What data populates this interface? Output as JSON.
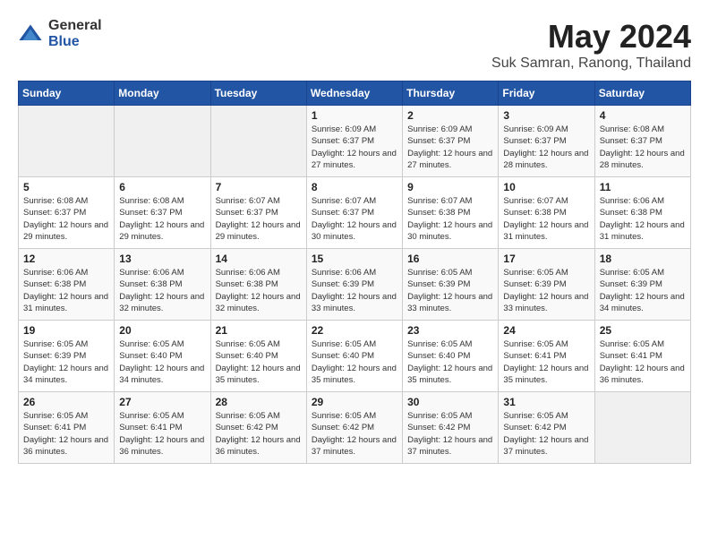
{
  "header": {
    "logo_general": "General",
    "logo_blue": "Blue",
    "month": "May 2024",
    "location": "Suk Samran, Ranong, Thailand"
  },
  "weekdays": [
    "Sunday",
    "Monday",
    "Tuesday",
    "Wednesday",
    "Thursday",
    "Friday",
    "Saturday"
  ],
  "weeks": [
    [
      {
        "day": "",
        "sunrise": "",
        "sunset": "",
        "daylight": ""
      },
      {
        "day": "",
        "sunrise": "",
        "sunset": "",
        "daylight": ""
      },
      {
        "day": "",
        "sunrise": "",
        "sunset": "",
        "daylight": ""
      },
      {
        "day": "1",
        "sunrise": "6:09 AM",
        "sunset": "6:37 PM",
        "daylight": "12 hours and 27 minutes."
      },
      {
        "day": "2",
        "sunrise": "6:09 AM",
        "sunset": "6:37 PM",
        "daylight": "12 hours and 27 minutes."
      },
      {
        "day": "3",
        "sunrise": "6:09 AM",
        "sunset": "6:37 PM",
        "daylight": "12 hours and 28 minutes."
      },
      {
        "day": "4",
        "sunrise": "6:08 AM",
        "sunset": "6:37 PM",
        "daylight": "12 hours and 28 minutes."
      }
    ],
    [
      {
        "day": "5",
        "sunrise": "6:08 AM",
        "sunset": "6:37 PM",
        "daylight": "12 hours and 29 minutes."
      },
      {
        "day": "6",
        "sunrise": "6:08 AM",
        "sunset": "6:37 PM",
        "daylight": "12 hours and 29 minutes."
      },
      {
        "day": "7",
        "sunrise": "6:07 AM",
        "sunset": "6:37 PM",
        "daylight": "12 hours and 29 minutes."
      },
      {
        "day": "8",
        "sunrise": "6:07 AM",
        "sunset": "6:37 PM",
        "daylight": "12 hours and 30 minutes."
      },
      {
        "day": "9",
        "sunrise": "6:07 AM",
        "sunset": "6:38 PM",
        "daylight": "12 hours and 30 minutes."
      },
      {
        "day": "10",
        "sunrise": "6:07 AM",
        "sunset": "6:38 PM",
        "daylight": "12 hours and 31 minutes."
      },
      {
        "day": "11",
        "sunrise": "6:06 AM",
        "sunset": "6:38 PM",
        "daylight": "12 hours and 31 minutes."
      }
    ],
    [
      {
        "day": "12",
        "sunrise": "6:06 AM",
        "sunset": "6:38 PM",
        "daylight": "12 hours and 31 minutes."
      },
      {
        "day": "13",
        "sunrise": "6:06 AM",
        "sunset": "6:38 PM",
        "daylight": "12 hours and 32 minutes."
      },
      {
        "day": "14",
        "sunrise": "6:06 AM",
        "sunset": "6:38 PM",
        "daylight": "12 hours and 32 minutes."
      },
      {
        "day": "15",
        "sunrise": "6:06 AM",
        "sunset": "6:39 PM",
        "daylight": "12 hours and 33 minutes."
      },
      {
        "day": "16",
        "sunrise": "6:05 AM",
        "sunset": "6:39 PM",
        "daylight": "12 hours and 33 minutes."
      },
      {
        "day": "17",
        "sunrise": "6:05 AM",
        "sunset": "6:39 PM",
        "daylight": "12 hours and 33 minutes."
      },
      {
        "day": "18",
        "sunrise": "6:05 AM",
        "sunset": "6:39 PM",
        "daylight": "12 hours and 34 minutes."
      }
    ],
    [
      {
        "day": "19",
        "sunrise": "6:05 AM",
        "sunset": "6:39 PM",
        "daylight": "12 hours and 34 minutes."
      },
      {
        "day": "20",
        "sunrise": "6:05 AM",
        "sunset": "6:40 PM",
        "daylight": "12 hours and 34 minutes."
      },
      {
        "day": "21",
        "sunrise": "6:05 AM",
        "sunset": "6:40 PM",
        "daylight": "12 hours and 35 minutes."
      },
      {
        "day": "22",
        "sunrise": "6:05 AM",
        "sunset": "6:40 PM",
        "daylight": "12 hours and 35 minutes."
      },
      {
        "day": "23",
        "sunrise": "6:05 AM",
        "sunset": "6:40 PM",
        "daylight": "12 hours and 35 minutes."
      },
      {
        "day": "24",
        "sunrise": "6:05 AM",
        "sunset": "6:41 PM",
        "daylight": "12 hours and 35 minutes."
      },
      {
        "day": "25",
        "sunrise": "6:05 AM",
        "sunset": "6:41 PM",
        "daylight": "12 hours and 36 minutes."
      }
    ],
    [
      {
        "day": "26",
        "sunrise": "6:05 AM",
        "sunset": "6:41 PM",
        "daylight": "12 hours and 36 minutes."
      },
      {
        "day": "27",
        "sunrise": "6:05 AM",
        "sunset": "6:41 PM",
        "daylight": "12 hours and 36 minutes."
      },
      {
        "day": "28",
        "sunrise": "6:05 AM",
        "sunset": "6:42 PM",
        "daylight": "12 hours and 36 minutes."
      },
      {
        "day": "29",
        "sunrise": "6:05 AM",
        "sunset": "6:42 PM",
        "daylight": "12 hours and 37 minutes."
      },
      {
        "day": "30",
        "sunrise": "6:05 AM",
        "sunset": "6:42 PM",
        "daylight": "12 hours and 37 minutes."
      },
      {
        "day": "31",
        "sunrise": "6:05 AM",
        "sunset": "6:42 PM",
        "daylight": "12 hours and 37 minutes."
      },
      {
        "day": "",
        "sunrise": "",
        "sunset": "",
        "daylight": ""
      }
    ]
  ],
  "labels": {
    "sunrise": "Sunrise:",
    "sunset": "Sunset:",
    "daylight": "Daylight:"
  }
}
